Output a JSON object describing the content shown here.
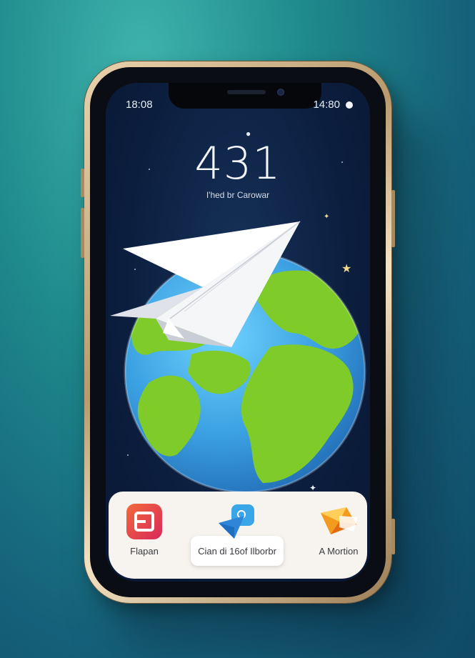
{
  "status_bar": {
    "left_time": "18:08",
    "right_time": "14:80"
  },
  "lockscreen": {
    "clock": "431",
    "date": "I'hed br Carowar"
  },
  "dock": {
    "apps": [
      {
        "label": "Flapan",
        "icon": "red-app-icon"
      },
      {
        "label": "Cian di 16of Ilborbr",
        "icon": "paper-plane-chat-icon"
      },
      {
        "label": "A Mortion",
        "icon": "envelope-mail-icon"
      }
    ]
  },
  "colors": {
    "background_teal": "#1f8a8c",
    "screen_navy": "#0c1e3e",
    "phone_frame_gold": "#d8bb8e",
    "globe_ocean": "#3a9fe0",
    "globe_land": "#7ecb2a"
  }
}
